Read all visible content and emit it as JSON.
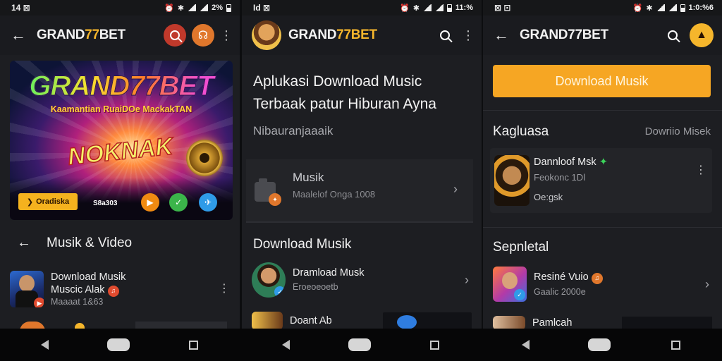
{
  "screens": [
    {
      "status": {
        "time": "14 ⊠",
        "right": "2%"
      },
      "appbar": {
        "brand_a": "GRAND",
        "brand_b": "77",
        "brand_c": "BET"
      },
      "banner": {
        "brand": "GRAND77BET",
        "subtitle": "Kaamantian RuaiDOe MackakTAN",
        "bigword": "NOKNAK",
        "cta_label": "Oradiska",
        "small_text": "S8a303"
      },
      "section": {
        "title": "Musik & Video"
      },
      "rows": [
        {
          "title": "Download Musik",
          "title2": "Muscic Alak",
          "subtitle": "Maaaat 1&63"
        }
      ]
    },
    {
      "status": {
        "time": "Id ⊠",
        "right": "11:%"
      },
      "appbar": {
        "brand_a": "GRAND",
        "brand_b": "77",
        "brand_c": "BET"
      },
      "headline": {
        "line1": "Aplukasi Download Music",
        "line2": "Terbaak patur Hiburan Ayna",
        "sub": "Nibauranjaaaik"
      },
      "card": {
        "title": "Musik",
        "subtitle": "Maalelof Onga 1008"
      },
      "section": {
        "title": "Download Musik"
      },
      "rows": [
        {
          "title": "Dramload Musk",
          "subtitle": "Eroeoeoetb"
        },
        {
          "title": "Doant Ab",
          "subtitle": ""
        }
      ]
    },
    {
      "status": {
        "time": "⊠ ⊡",
        "right": "1:0:%6"
      },
      "appbar": {
        "brand_a": "GRAND",
        "brand_b": "77",
        "brand_c": "BET"
      },
      "download_button": "Download Musik",
      "section1": {
        "title": "Kagluasa",
        "right": "Dowriio Misek"
      },
      "featured": {
        "title": "Dannloof Msk",
        "line2": "Feokonc 1Dl",
        "line3": "Oe:gsk"
      },
      "section2": {
        "title": "Sepnletal"
      },
      "rows": [
        {
          "title": "Resiné Vuio",
          "subtitle": "Gaalic 2000e"
        },
        {
          "title": "Pamlcah",
          "subtitle": ""
        }
      ]
    }
  ],
  "colors": {
    "accent": "#f5b62c",
    "bg": "#1d1e22",
    "appbar": "#1a1b1f",
    "navbar": "#060607"
  }
}
